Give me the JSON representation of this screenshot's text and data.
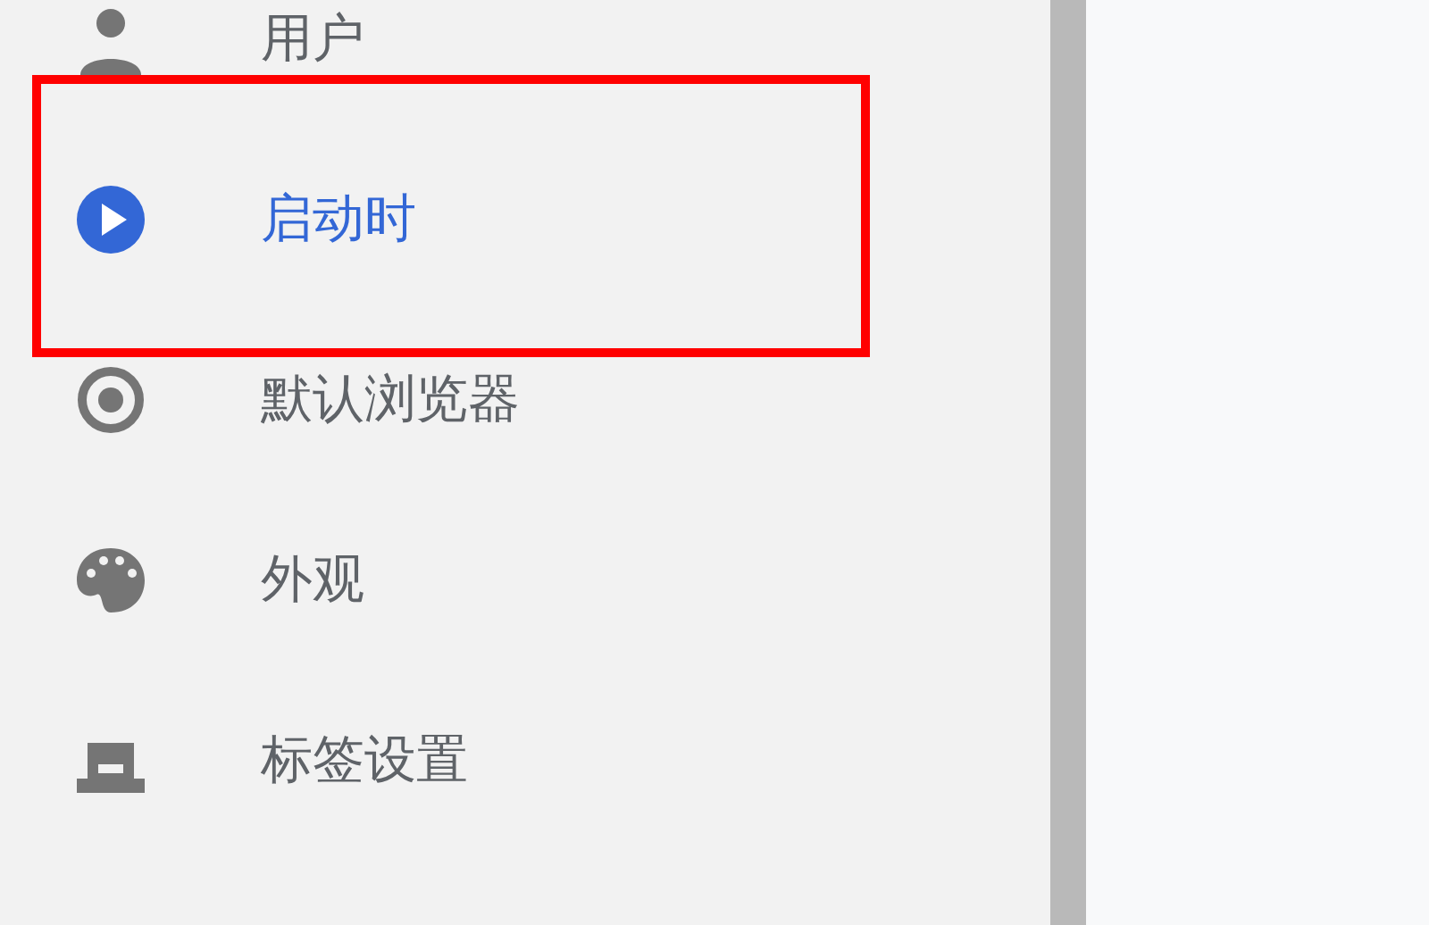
{
  "sidebar": {
    "items": [
      {
        "label": "用户",
        "selected": false,
        "highlighted": false
      },
      {
        "label": "启动时",
        "selected": true,
        "highlighted": true
      },
      {
        "label": "默认浏览器",
        "selected": false,
        "highlighted": false
      },
      {
        "label": "外观",
        "selected": false,
        "highlighted": false
      },
      {
        "label": "标签设置",
        "selected": false,
        "highlighted": false
      }
    ]
  }
}
